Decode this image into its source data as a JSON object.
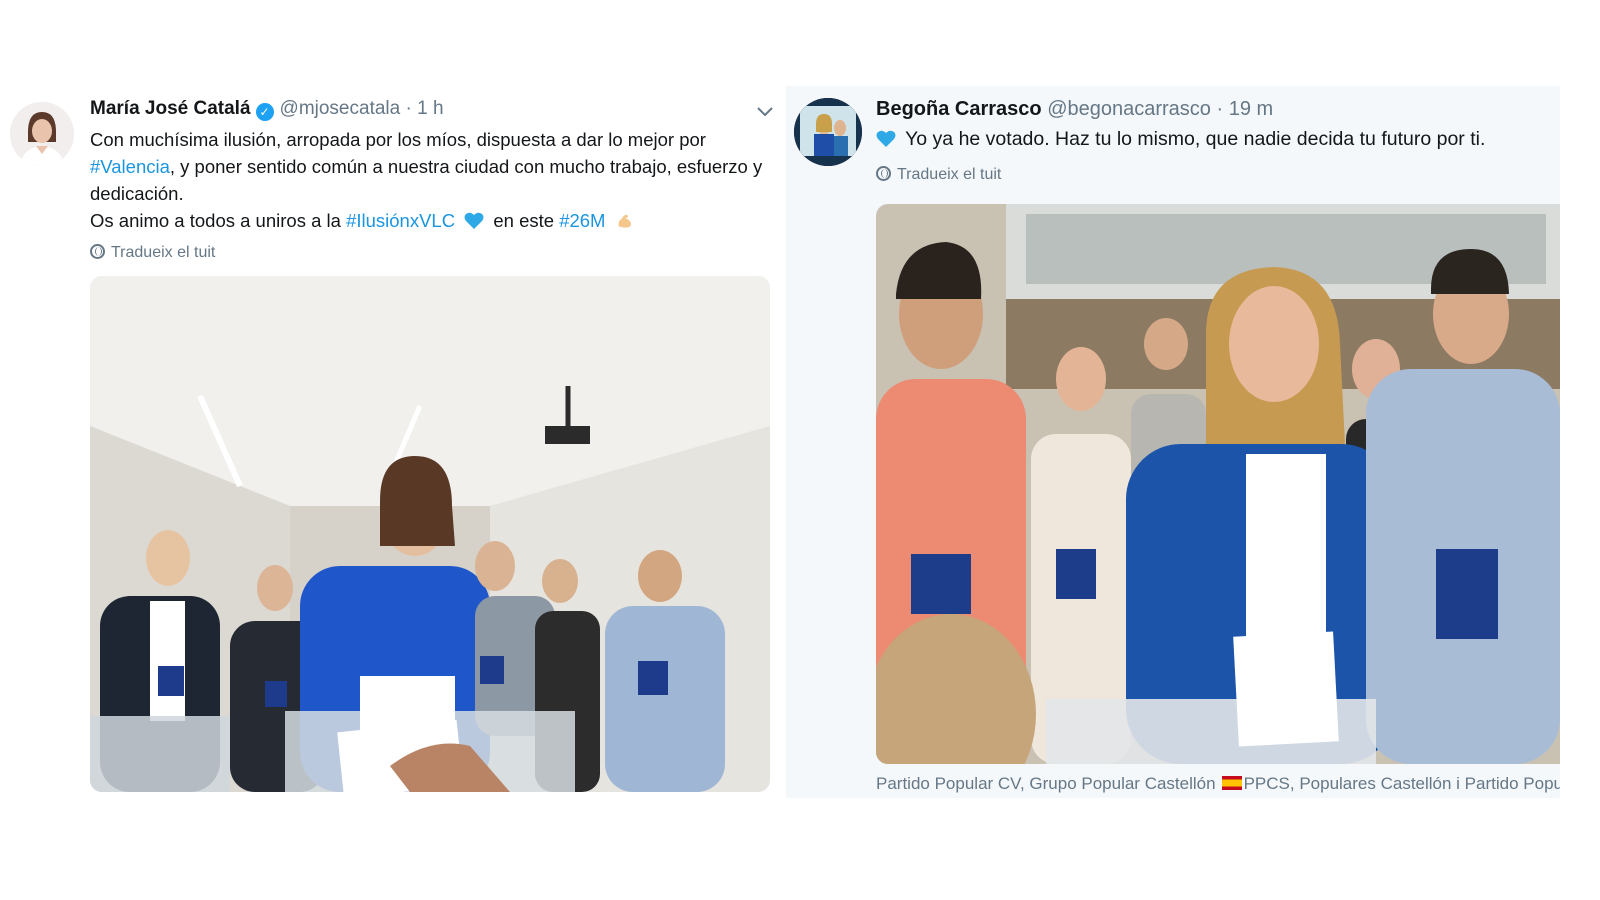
{
  "tweet_left": {
    "author_name": "María José Catalá",
    "handle": "@mjosecatala",
    "separator": "·",
    "time": "1 h",
    "text_line1": "Con muchísima ilusión, arropada por los míos, dispuesta a dar lo mejor por",
    "hashtag_valencia": "#Valencia",
    "text_line2_rest": ", y poner sentido común a nuestra ciudad con mucho trabajo, esfuerzo y dedicación.",
    "text_line3_a": "Os animo a todos a uniros a la",
    "hashtag_ilusion": "#IlusiónxVLC",
    "text_line3_b": "en este",
    "hashtag_26m": "#26M",
    "translate_label": "Tradueix el tuit",
    "icons": [
      "verified-badge-icon",
      "chevron-down-icon",
      "blue-heart-icon",
      "flexed-biceps-icon",
      "globe-icon"
    ]
  },
  "tweet_right": {
    "author_name": "Begoña Carrasco",
    "handle": "@begonacarrasco",
    "separator": "·",
    "time": "19 m",
    "text": "Yo ya he votado. Haz tu lo mismo, que nadie decida tu futuro por ti.",
    "translate_label": "Tradueix el tuit",
    "tagged_a": "Partido Popular CV, Grupo Popular Castellón",
    "tagged_b": "PPCS, Populares Castellón i Partido Popular",
    "icons": [
      "blue-heart-icon",
      "globe-icon",
      "spain-flag-icon"
    ]
  },
  "colors": {
    "link": "#1b95e0",
    "muted": "#657786",
    "text": "#14171a",
    "verified": "#1da1f2",
    "right_card_bg": "#f5f8fa"
  }
}
